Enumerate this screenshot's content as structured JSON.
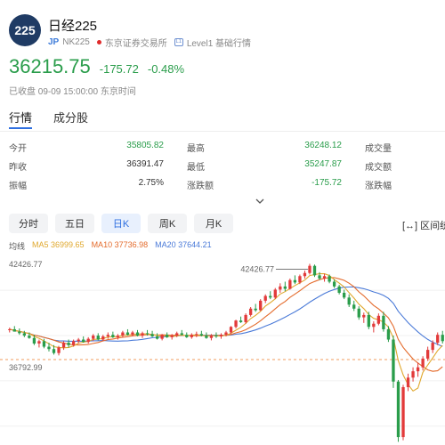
{
  "header": {
    "logo_text": "225",
    "title": "日经225",
    "market_tag": "JP",
    "code": "NK225",
    "exchange": "东京证券交易所",
    "level_icon": "L1",
    "level": "Level1 基础行情"
  },
  "quote": {
    "price": "36215.75",
    "change": "-175.72",
    "change_pct": "-0.48%",
    "status": "已收盘 09-09 15:00:00 东京时间"
  },
  "tabs": [
    {
      "label": "行情",
      "active": true
    },
    {
      "label": "成分股",
      "active": false
    }
  ],
  "stats": [
    {
      "l1": "今开",
      "v1": "35805.82",
      "l2": "最高",
      "v2": "36248.12",
      "l3": "成交量"
    },
    {
      "l1": "昨收",
      "v1": "36391.47",
      "l2": "最低",
      "v2": "35247.87",
      "l3": "成交额"
    },
    {
      "l1": "振幅",
      "v1": "2.75%",
      "l2": "涨跌额",
      "v2": "-175.72",
      "l3": "涨跌幅"
    }
  ],
  "expand_icon": "chevron-down-icon",
  "periods": [
    {
      "label": "分时",
      "active": false
    },
    {
      "label": "五日",
      "active": false
    },
    {
      "label": "日K",
      "active": true
    },
    {
      "label": "周K",
      "active": false
    },
    {
      "label": "月K",
      "active": false
    }
  ],
  "range_button": "[↔] 区间统",
  "ma": {
    "avg_label": "均线",
    "ma5": "MA5 36999.65",
    "ma10": "MA10 37736.98",
    "ma20": "MA20 37644.21"
  },
  "colors": {
    "up": "#e23a3a",
    "down": "#2a9d4b",
    "ma5": "#e0a82e",
    "ma10": "#e46b2c",
    "ma20": "#4a7ad8",
    "accent": "#2f6fe0"
  },
  "chart_data": {
    "type": "candlestick",
    "y_top_label": "42426.77",
    "y_bottom_label": "36792.99",
    "max_marker": "42426.77",
    "ylim": [
      31000,
      42900
    ],
    "reference_line": 36391.47,
    "candles": [
      [
        38250,
        38400,
        38100,
        38300
      ],
      [
        38300,
        38500,
        38200,
        38150
      ],
      [
        38150,
        38350,
        37950,
        38050
      ],
      [
        38050,
        38200,
        37800,
        37900
      ],
      [
        37900,
        38100,
        37700,
        37750
      ],
      [
        37750,
        37950,
        37300,
        37400
      ],
      [
        37400,
        37650,
        37150,
        37550
      ],
      [
        37550,
        37700,
        37100,
        37200
      ],
      [
        37200,
        37450,
        36900,
        37050
      ],
      [
        37050,
        37300,
        36700,
        36800
      ],
      [
        36800,
        37250,
        36650,
        37150
      ],
      [
        37150,
        37550,
        37000,
        37450
      ],
      [
        37450,
        37650,
        37150,
        37300
      ],
      [
        37300,
        37650,
        37200,
        37550
      ],
      [
        37550,
        37750,
        37400,
        37650
      ],
      [
        37650,
        37850,
        37450,
        37500
      ],
      [
        37500,
        37800,
        37400,
        37700
      ],
      [
        37700,
        38000,
        37550,
        37900
      ],
      [
        37900,
        38050,
        37600,
        37650
      ],
      [
        37650,
        37950,
        37550,
        37850
      ],
      [
        37850,
        38100,
        37700,
        37950
      ],
      [
        37950,
        38150,
        37750,
        37800
      ],
      [
        37800,
        38000,
        37650,
        37900
      ],
      [
        37900,
        38200,
        37800,
        38100
      ],
      [
        38100,
        38300,
        37900,
        37950
      ],
      [
        37950,
        38200,
        37850,
        38100
      ],
      [
        38100,
        38250,
        37850,
        37900
      ],
      [
        37900,
        38150,
        37750,
        38050
      ],
      [
        38050,
        38250,
        37900,
        38000
      ],
      [
        38000,
        38200,
        37800,
        37850
      ],
      [
        37850,
        38050,
        37650,
        37700
      ],
      [
        37700,
        38000,
        37600,
        37950
      ],
      [
        37950,
        38100,
        37750,
        37800
      ],
      [
        37800,
        38000,
        37650,
        37900
      ],
      [
        37900,
        38150,
        37800,
        38050
      ],
      [
        38050,
        38250,
        37900,
        37950
      ],
      [
        37950,
        38100,
        37750,
        37800
      ],
      [
        37800,
        38050,
        37700,
        37950
      ],
      [
        37950,
        38150,
        37800,
        38000
      ],
      [
        38000,
        38200,
        37850,
        37900
      ],
      [
        37900,
        38100,
        37700,
        37750
      ],
      [
        37750,
        38000,
        37600,
        37900
      ],
      [
        37900,
        38100,
        37750,
        37850
      ],
      [
        37850,
        38050,
        37700,
        37950
      ],
      [
        37950,
        38200,
        37850,
        38100
      ],
      [
        38100,
        38500,
        38000,
        38450
      ],
      [
        38450,
        38900,
        38350,
        38850
      ],
      [
        38850,
        39100,
        38700,
        38750
      ],
      [
        38750,
        39300,
        38650,
        39200
      ],
      [
        39200,
        39700,
        39100,
        39600
      ],
      [
        39600,
        39900,
        39400,
        39500
      ],
      [
        39500,
        40200,
        39450,
        40100
      ],
      [
        40100,
        40500,
        39950,
        40400
      ],
      [
        40400,
        40700,
        40200,
        40300
      ],
      [
        40300,
        40900,
        40200,
        40800
      ],
      [
        40800,
        41200,
        40600,
        41000
      ],
      [
        41000,
        41300,
        40700,
        40850
      ],
      [
        40850,
        41500,
        40800,
        41400
      ],
      [
        41400,
        41700,
        41150,
        41250
      ],
      [
        41250,
        41750,
        41150,
        41650
      ],
      [
        41650,
        42000,
        41500,
        41850
      ],
      [
        41850,
        42427,
        41750,
        42300
      ],
      [
        42300,
        42380,
        41600,
        41700
      ],
      [
        41700,
        41900,
        41400,
        41500
      ],
      [
        41500,
        41800,
        41300,
        41650
      ],
      [
        41650,
        41750,
        41200,
        41300
      ],
      [
        41300,
        41450,
        40900,
        41000
      ],
      [
        41000,
        41100,
        40500,
        40600
      ],
      [
        40600,
        40800,
        40200,
        40300
      ],
      [
        40300,
        40500,
        39700,
        39850
      ],
      [
        39850,
        40100,
        39450,
        39600
      ],
      [
        39600,
        39750,
        38900,
        39050
      ],
      [
        39050,
        39350,
        38700,
        39200
      ],
      [
        39200,
        39400,
        38300,
        38450
      ],
      [
        38450,
        38800,
        38100,
        38650
      ],
      [
        38650,
        39300,
        38550,
        39150
      ],
      [
        39150,
        39400,
        38150,
        38300
      ],
      [
        38300,
        38500,
        37500,
        37650
      ],
      [
        37650,
        37900,
        34600,
        35000
      ],
      [
        35000,
        35100,
        31200,
        31500
      ],
      [
        31500,
        34800,
        31300,
        34650
      ],
      [
        34650,
        35500,
        34400,
        35250
      ],
      [
        35250,
        35900,
        35000,
        35650
      ],
      [
        35650,
        36200,
        35300,
        35900
      ],
      [
        35900,
        36600,
        35700,
        36450
      ],
      [
        36450,
        37200,
        36300,
        37000
      ],
      [
        37000,
        37600,
        36800,
        37450
      ],
      [
        37450,
        38100,
        37300,
        37950
      ],
      [
        37950,
        38200,
        37400,
        37550
      ]
    ]
  }
}
